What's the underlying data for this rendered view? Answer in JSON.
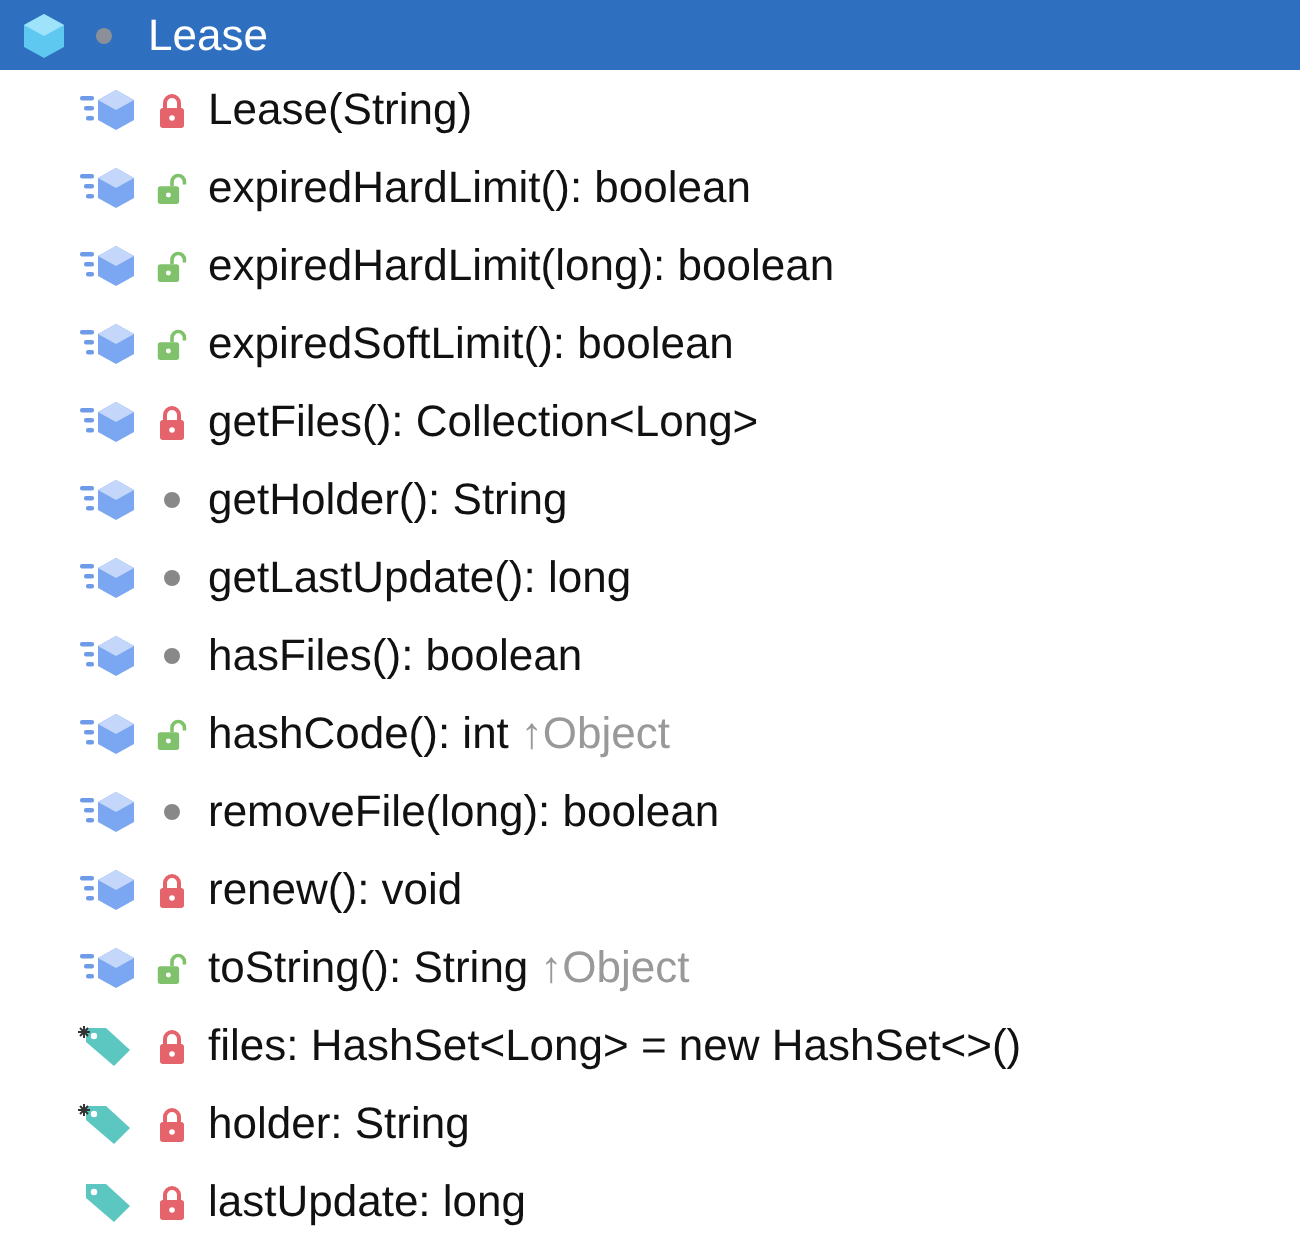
{
  "tree": {
    "label": "Lease",
    "kind": "class",
    "modifier": {
      "kind": "package"
    },
    "selected": true,
    "children": [
      {
        "label": "Lease(String)",
        "kind": "method",
        "modifier": {
          "kind": "private"
        },
        "selected": false
      },
      {
        "label": "expiredHardLimit(): boolean",
        "kind": "method",
        "modifier": {
          "kind": "public"
        },
        "selected": false
      },
      {
        "label": "expiredHardLimit(long): boolean",
        "kind": "method",
        "modifier": {
          "kind": "public"
        },
        "selected": false
      },
      {
        "label": "expiredSoftLimit(): boolean",
        "kind": "method",
        "modifier": {
          "kind": "public"
        },
        "selected": false
      },
      {
        "label": "getFiles(): Collection<Long>",
        "kind": "method",
        "modifier": {
          "kind": "private"
        },
        "selected": false
      },
      {
        "label": "getHolder(): String",
        "kind": "method",
        "modifier": {
          "kind": "package"
        },
        "selected": false
      },
      {
        "label": "getLastUpdate(): long",
        "kind": "method",
        "modifier": {
          "kind": "package"
        },
        "selected": false
      },
      {
        "label": "hasFiles(): boolean",
        "kind": "method",
        "modifier": {
          "kind": "package"
        },
        "selected": false
      },
      {
        "label": "hashCode(): int",
        "inherited": "↑Object",
        "kind": "method",
        "modifier": {
          "kind": "public"
        },
        "selected": false
      },
      {
        "label": "removeFile(long): boolean",
        "kind": "method",
        "modifier": {
          "kind": "package"
        },
        "selected": false
      },
      {
        "label": "renew(): void",
        "kind": "method",
        "modifier": {
          "kind": "private"
        },
        "selected": false
      },
      {
        "label": "toString(): String",
        "inherited": "↑Object",
        "kind": "method",
        "modifier": {
          "kind": "public"
        },
        "selected": false
      },
      {
        "label": "files: HashSet<Long> = new HashSet<>()",
        "kind": "field",
        "modifier": {
          "kind": "private"
        },
        "final": true,
        "selected": false
      },
      {
        "label": "holder: String",
        "kind": "field",
        "modifier": {
          "kind": "private"
        },
        "final": true,
        "selected": false
      },
      {
        "label": "lastUpdate: long",
        "kind": "field",
        "modifier": {
          "kind": "private"
        },
        "final": false,
        "selected": false
      }
    ]
  }
}
